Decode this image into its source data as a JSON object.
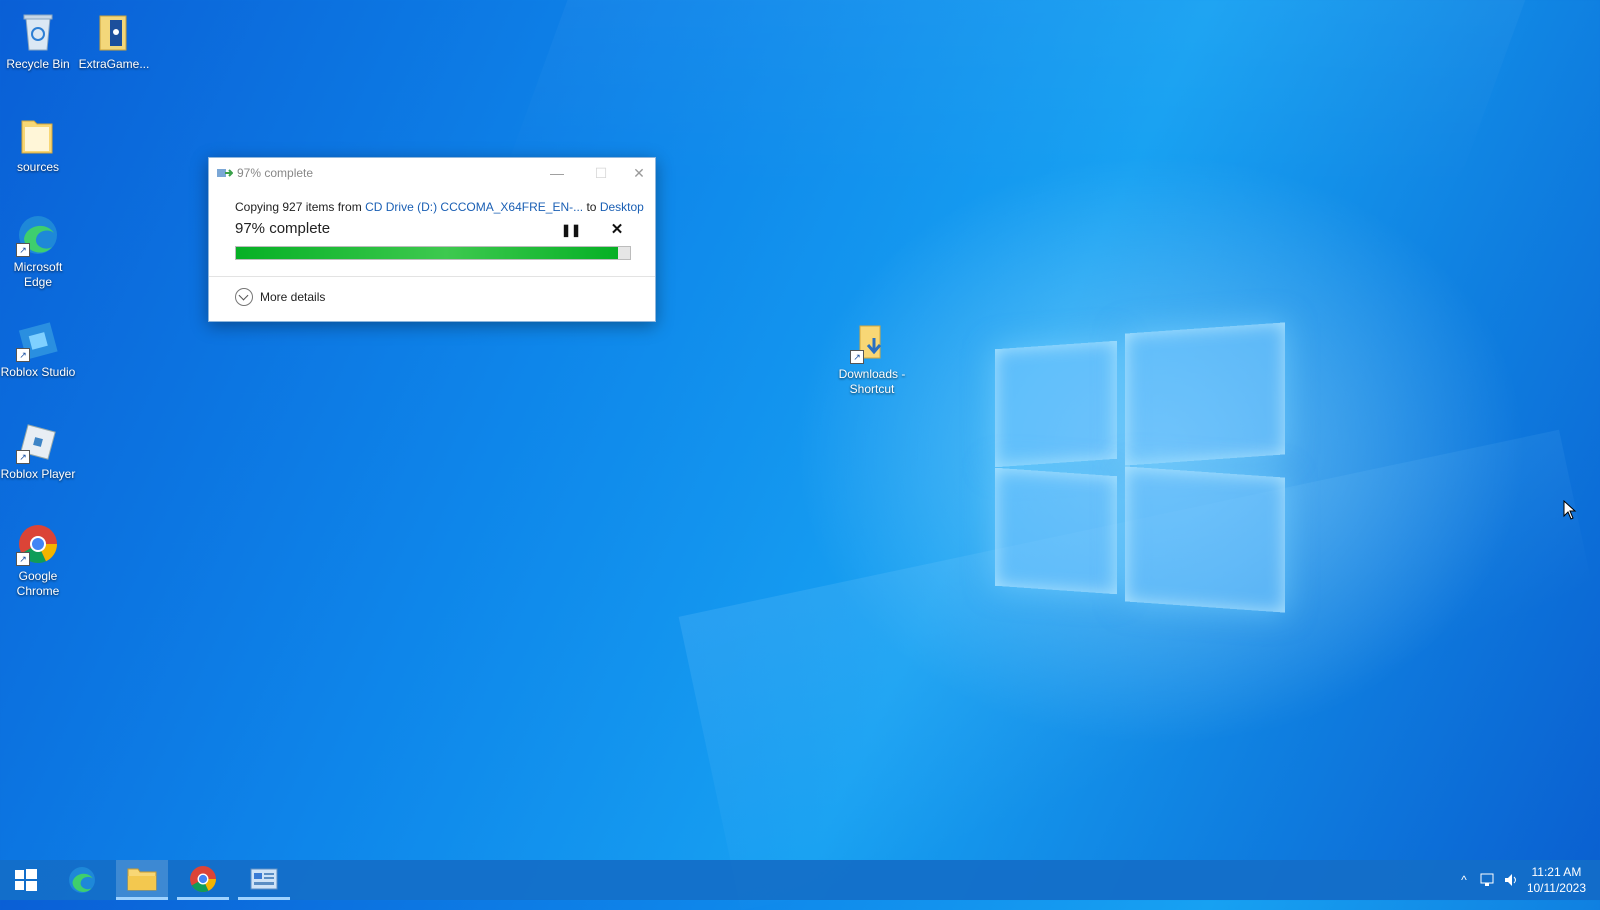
{
  "desktop": {
    "icons": [
      {
        "label": "Recycle Bin",
        "icon": "recycle-bin-icon"
      },
      {
        "label": "ExtraGame...",
        "icon": "extragame-icon"
      },
      {
        "label": "sources",
        "icon": "folder-icon"
      },
      {
        "label": "Microsoft Edge",
        "icon": "edge-icon"
      },
      {
        "label": "Roblox Studio",
        "icon": "roblox-studio-icon"
      },
      {
        "label": "Roblox Player",
        "icon": "roblox-player-icon"
      },
      {
        "label": "Google Chrome",
        "icon": "chrome-icon"
      },
      {
        "label": "Downloads - Shortcut",
        "icon": "downloads-folder-icon"
      }
    ]
  },
  "dialog": {
    "title": "97% complete",
    "copy_prefix": "Copying 927 items from",
    "source": "CD Drive (D:) CCCOMA_X64FRE_EN-...",
    "to_word": "to",
    "destination": "Desktop",
    "percent_text": "97% complete",
    "progress_percent": 97,
    "pause_symbol": "❚❚",
    "stop_symbol": "✕",
    "more_details": "More details",
    "min_symbol": "—",
    "max_symbol": "☐",
    "close_symbol": "✕"
  },
  "taskbar": {
    "items": [
      "start-button",
      "edge",
      "file-explorer",
      "chrome",
      "control-panel"
    ],
    "tray_chevron": "^",
    "time": "11:21 AM",
    "date": "10/11/2023"
  },
  "colors": {
    "progress_green": "#06b025",
    "link_blue": "#1a5fb4",
    "taskbar": "#146ec8"
  }
}
